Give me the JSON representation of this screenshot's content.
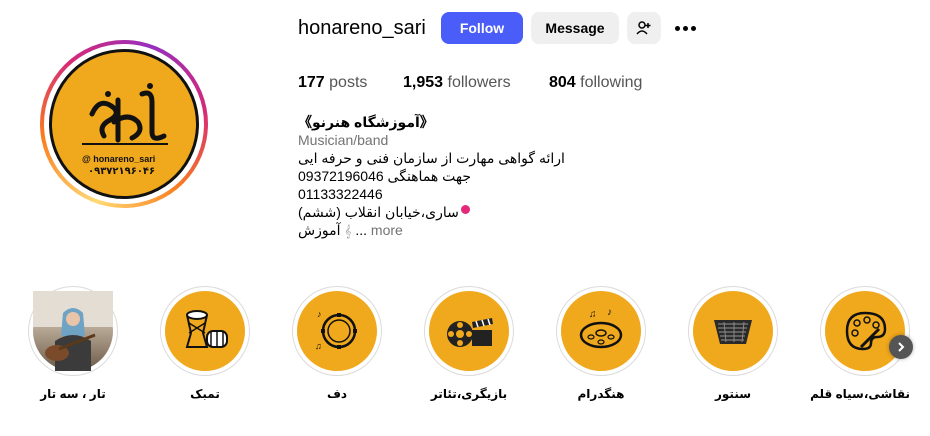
{
  "profile": {
    "username": "honareno_sari",
    "follow_label": "Follow",
    "message_label": "Message",
    "add_user_icon": "person-plus-icon",
    "more_icon": "ellipsis-icon",
    "avatar": {
      "handle": "@ honareno_sari",
      "phone": "۰۹۳۷۲۱۹۶۰۴۶"
    }
  },
  "stats": {
    "posts_count": "177",
    "posts_label": "posts",
    "followers_count": "1,953",
    "followers_label": "followers",
    "following_count": "804",
    "following_label": "following"
  },
  "bio": {
    "name": "《آموزشگاه هنرنو》",
    "category": "Musician/band",
    "lines": [
      "ارائه گواهی مهارت از سازمان فنی و حرفه ایی",
      "جهت هماهنگی 09372196046",
      "01133322446",
      "ساری،خیابان انقلاب (ششم)"
    ],
    "last_line_prefix": "آموزش",
    "last_line_suffix": "... ",
    "more_label": "more"
  },
  "highlights": [
    {
      "label": "تار ، سه تار",
      "icon": "musician-photo"
    },
    {
      "label": "تمبک",
      "icon": "drum-icon"
    },
    {
      "label": "دف",
      "icon": "tambourine-icon"
    },
    {
      "label": "بازیگری،تئاتر",
      "icon": "film-clapper-icon"
    },
    {
      "label": "هنگدرام",
      "icon": "handpan-icon"
    },
    {
      "label": "سنتور",
      "icon": "santur-icon"
    },
    {
      "label": "نقاشی،سیاه قلم",
      "icon": "palette-icon"
    }
  ],
  "colors": {
    "accent": "#4a5df9",
    "highlight_bg": "#f0a81c",
    "pin": "#e4287a"
  }
}
